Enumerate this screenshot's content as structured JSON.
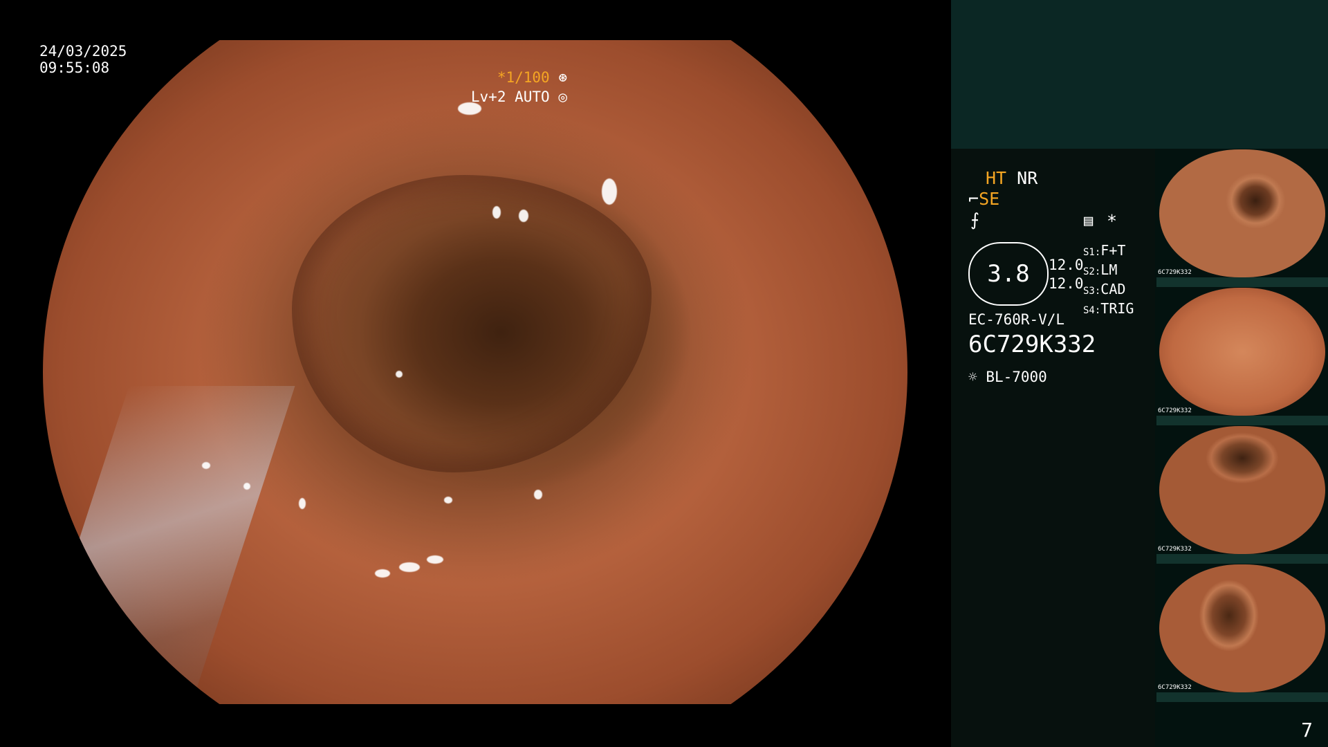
{
  "main": {
    "date": "24/03/2025",
    "time": "09:55:08",
    "shutter": "*1/100",
    "level": "Lv+2 AUTO"
  },
  "panel": {
    "ht": "HT",
    "nr": "NR",
    "se": "SE",
    "zoom": "3.8",
    "value1": "12.0",
    "value2": "12.0",
    "s1": "S1:",
    "s1_val": "F+T",
    "s2": "S2:",
    "s2_val": "LM",
    "s3": "S3:",
    "s3_val": "CAD",
    "s4": "S4:",
    "s4_val": "TRIG",
    "scope_model": "EC-760R-V/L",
    "scope_serial": "6C729K332",
    "light_source": "BL-7000",
    "asterisk": "*"
  },
  "thumbnails": [
    {
      "label": "6C729K332"
    },
    {
      "label": "6C729K332"
    },
    {
      "label": "6C729K332"
    },
    {
      "label": "6C729K332"
    }
  ],
  "page_number": "7",
  "colors": {
    "accent": "#f5a623",
    "panel_bg": "#03120f",
    "panel_top": "#0b2724"
  }
}
